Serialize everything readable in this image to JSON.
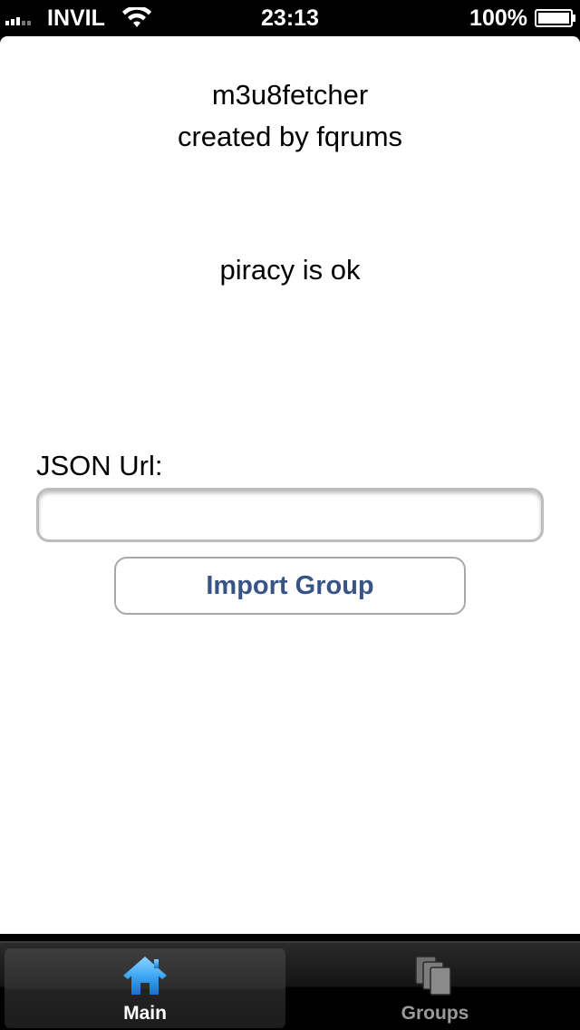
{
  "status_bar": {
    "carrier": "INVIL",
    "time": "23:13",
    "battery_percent": "100%"
  },
  "main": {
    "app_name": "m3u8fetcher",
    "credit": "created by fqrums",
    "tagline": "piracy is ok",
    "json_url_label": "JSON Url:",
    "json_url_value": "",
    "json_url_placeholder": "",
    "import_button_label": "Import Group"
  },
  "tab_bar": {
    "tabs": [
      {
        "label": "Main",
        "icon": "home-icon",
        "selected": true
      },
      {
        "label": "Groups",
        "icon": "groups-icon",
        "selected": false
      }
    ]
  },
  "colors": {
    "button_text": "#385487",
    "tab_selected_icon": "#3fa9f5",
    "tab_unselected_icon": "#8a8a8a"
  }
}
